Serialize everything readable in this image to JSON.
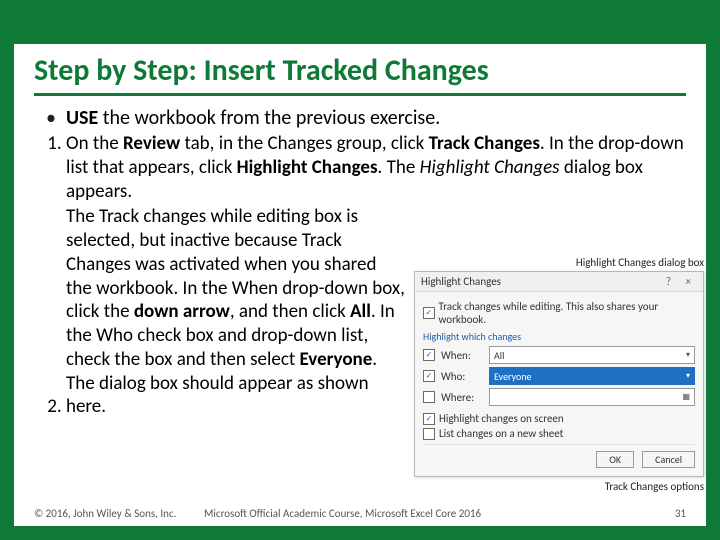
{
  "title": "Step by Step: Insert Tracked Changes",
  "use_line": {
    "prefix": "USE",
    "rest": " the workbook from the previous exercise."
  },
  "steps": [
    {
      "html": "On the <b>Review</b> tab, in the Changes group, click <b>Track Changes</b>. In the drop-down list that appears, click <b>Highlight Changes</b>. The <i>Highlight Changes</i> dialog box appears."
    },
    {
      "html": "The Track changes while editing box is selected, but inactive because Track Changes was activated when you shared the workbook. In the When drop-down box, click the <b>down arrow</b>, and then click <b>All</b>. In the Who check box and drop-down list, check the box and then select <b>Everyone</b>. The dialog box should appear as shown here."
    }
  ],
  "dialog": {
    "callout_top": "Highlight Changes dialog box",
    "callout_bottom": "Track Changes options",
    "title": "Highlight Changes",
    "track_line": "Track changes while editing. This also shares your workbook.",
    "group": "Highlight which changes",
    "when_label": "When:",
    "when_value": "All",
    "who_label": "Who:",
    "who_value": "Everyone",
    "where_label": "Where:",
    "opt1": "Highlight changes on screen",
    "opt2": "List changes on a new sheet",
    "ok": "OK",
    "cancel": "Cancel"
  },
  "footer": {
    "copyright": "© 2016, John Wiley & Sons, Inc.",
    "course": "Microsoft Official Academic Course, Microsoft Excel Core 2016",
    "page": "31"
  }
}
